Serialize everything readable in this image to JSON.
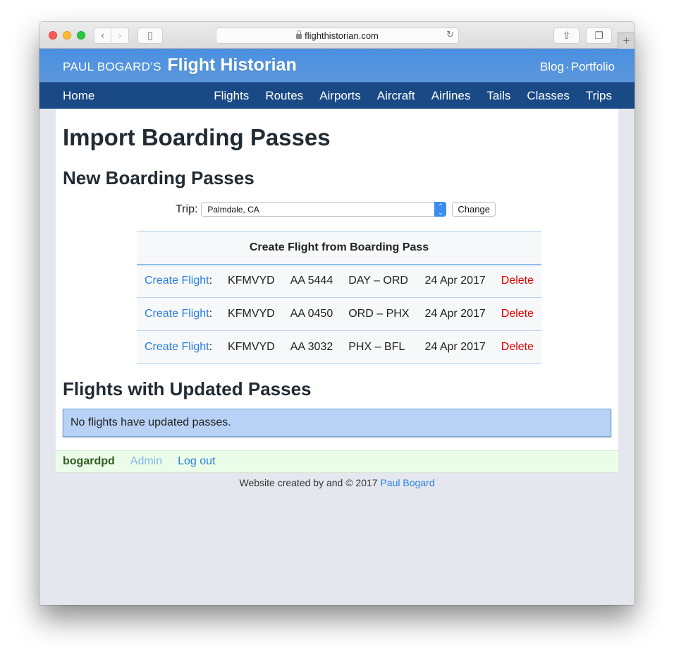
{
  "browser": {
    "url": "flighthistorian.com",
    "icons": {
      "back": "chevron-left-icon",
      "forward": "chevron-right-icon",
      "sidebar": "sidebar-icon",
      "lock": "lock-icon",
      "reload": "reload-icon",
      "share": "share-icon",
      "tabs": "tabs-icon",
      "new_tab": "plus-icon"
    },
    "glyphs": {
      "back": "‹",
      "forward": "›",
      "sidebar": "▯",
      "reload": "↻",
      "share": "⇪",
      "tabs": "❐",
      "new_tab": "+"
    }
  },
  "header": {
    "brand_small": "PAUL BOGARD’S",
    "brand_big": "Flight Historian",
    "links": [
      {
        "label": "Blog"
      },
      {
        "label": "Portfolio"
      }
    ],
    "link_separator": "·"
  },
  "nav": {
    "home": "Home",
    "items": [
      {
        "label": "Flights"
      },
      {
        "label": "Routes"
      },
      {
        "label": "Airports"
      },
      {
        "label": "Aircraft"
      },
      {
        "label": "Airlines"
      },
      {
        "label": "Tails"
      },
      {
        "label": "Classes"
      },
      {
        "label": "Trips"
      }
    ]
  },
  "main": {
    "title": "Import Boarding Passes",
    "new_section": {
      "title": "New Boarding Passes",
      "trip_label": "Trip:",
      "trip_selected": "Palmdale, CA",
      "change_button": "Change",
      "table": {
        "header": "Create Flight from Boarding Pass",
        "rows": [
          {
            "action": "Create Flight",
            "colon": ":",
            "pnr": "KFMVYD",
            "flight": "AA 5444",
            "route": "DAY – ORD",
            "date": "24 Apr 2017",
            "delete": "Delete"
          },
          {
            "action": "Create Flight",
            "colon": ":",
            "pnr": "KFMVYD",
            "flight": "AA 0450",
            "route": "ORD – PHX",
            "date": "24 Apr 2017",
            "delete": "Delete"
          },
          {
            "action": "Create Flight",
            "colon": ":",
            "pnr": "KFMVYD",
            "flight": "AA 3032",
            "route": "PHX – BFL",
            "date": "24 Apr 2017",
            "delete": "Delete"
          }
        ]
      }
    },
    "updated_section": {
      "title": "Flights with Updated Passes",
      "empty_message": "No flights have updated passes."
    }
  },
  "footer": {
    "username": "bogardpd",
    "admin": "Admin",
    "logout": "Log out",
    "copyright_text": "Website created by and © 2017",
    "copyright_link": "Paul Bogard"
  },
  "colors": {
    "header_blue": "#4a90e2",
    "nav_dark_blue": "#1a4a86",
    "link_blue": "#2b7fe0",
    "delete_red": "#e00000",
    "info_alert_bg": "#b7d2f5",
    "footer_bar_bg": "#ebfde9"
  }
}
